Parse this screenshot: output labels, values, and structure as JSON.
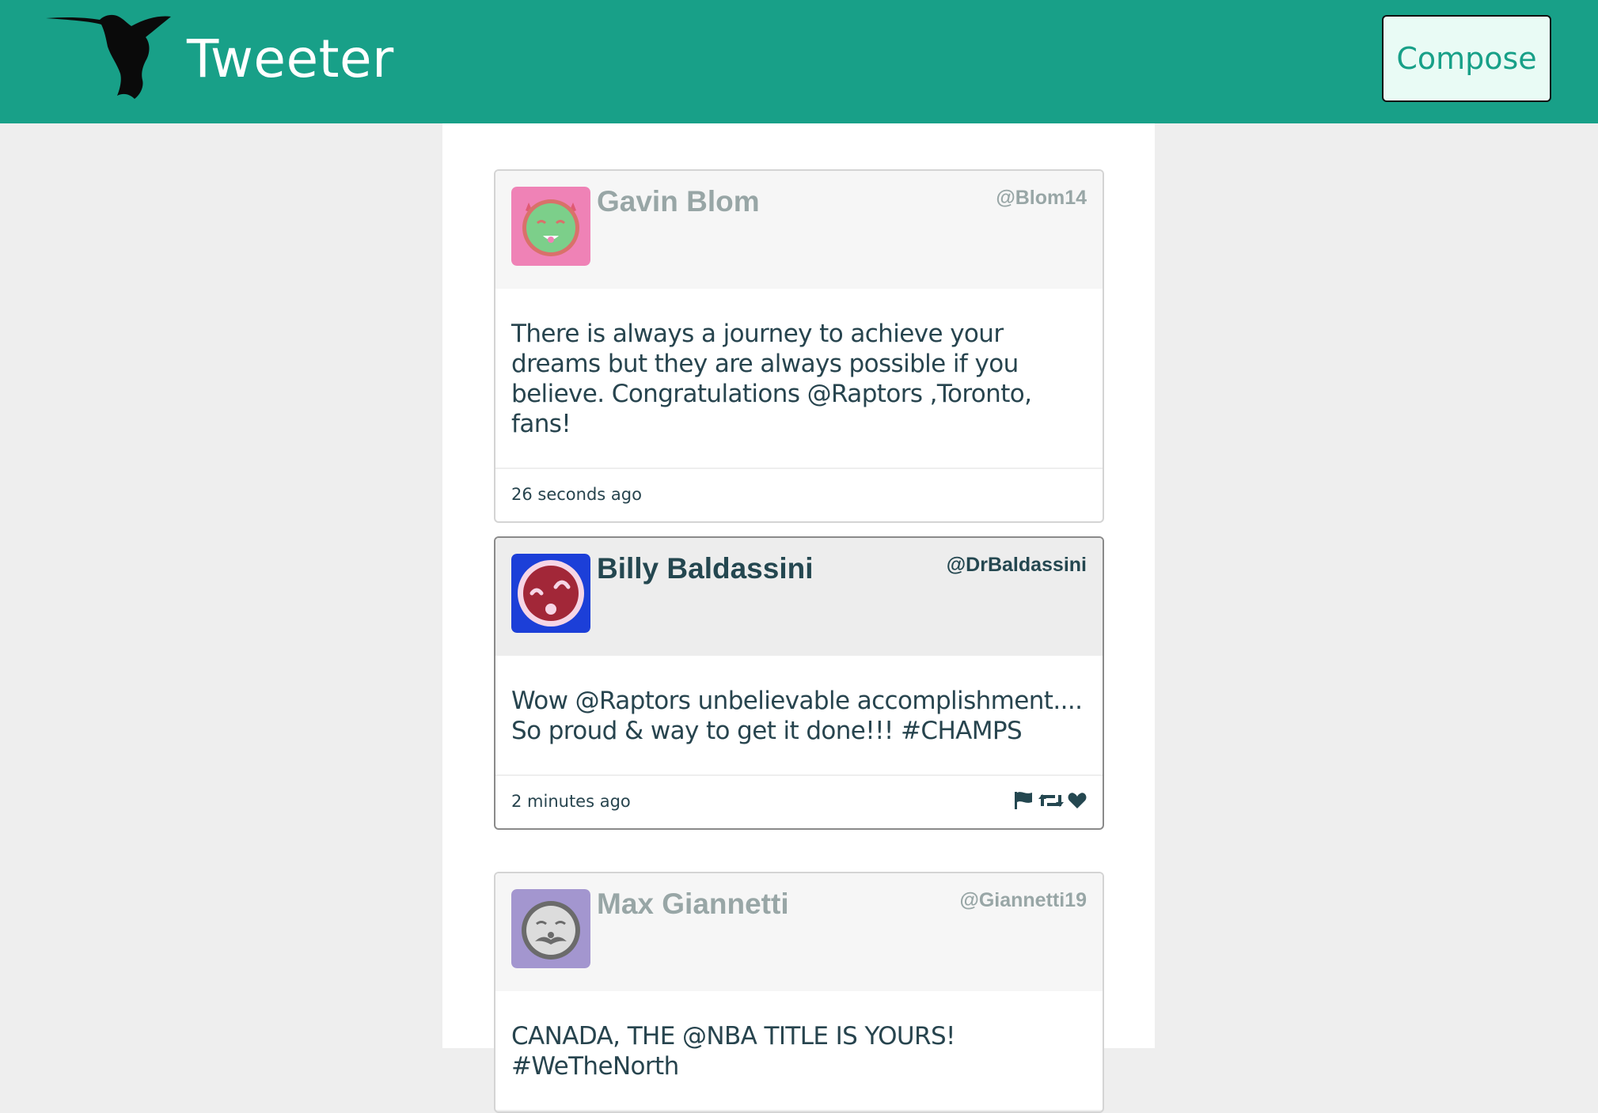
{
  "app": {
    "brand": "Tweeter",
    "compose_label": "Compose",
    "colors": {
      "brand": "#18a088",
      "text_dark": "#244750",
      "text_muted": "#98a6a6"
    }
  },
  "tweets": [
    {
      "name": "Gavin Blom",
      "handle": "@Blom14",
      "content": "There is always a journey to achieve your dreams but they are always possible if you believe. Congratulations @Raptors ,Toronto, fans!",
      "time": "26 seconds ago",
      "avatar": "green-devil-face-avatar",
      "active": false
    },
    {
      "name": "Billy Baldassini",
      "handle": "@DrBaldassini",
      "content": "Wow @Raptors unbelievable accomplishment.... So proud & way to get it done!!! #CHAMPS",
      "time": "2 minutes ago",
      "avatar": "red-face-avatar",
      "active": true,
      "actions": [
        "flag-icon",
        "retweet-icon",
        "heart-icon"
      ]
    },
    {
      "name": "Max Giannetti",
      "handle": "@Giannetti19",
      "content": "CANADA, THE @NBA TITLE IS YOURS! #WeTheNorth",
      "avatar": "mustache-face-avatar",
      "active": false
    }
  ]
}
